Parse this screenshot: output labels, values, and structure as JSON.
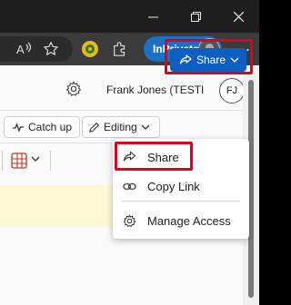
{
  "browser": {
    "inprivate_label": "InPrivate"
  },
  "header": {
    "user_name": "Frank Jones (TESTI",
    "avatar_initials": "FJ"
  },
  "commands": {
    "catch_up_label": "Catch up",
    "editing_label": "Editing",
    "share_label": "Share"
  },
  "share_menu": {
    "items": [
      {
        "label": "Share",
        "icon": "share-icon"
      },
      {
        "label": "Copy Link",
        "icon": "link-icon"
      },
      {
        "label": "Manage Access",
        "icon": "gear-icon"
      }
    ]
  },
  "colors": {
    "primary": "#0f5fc2",
    "highlight": "#e3001b",
    "inprivate": "#1d6fc4"
  }
}
